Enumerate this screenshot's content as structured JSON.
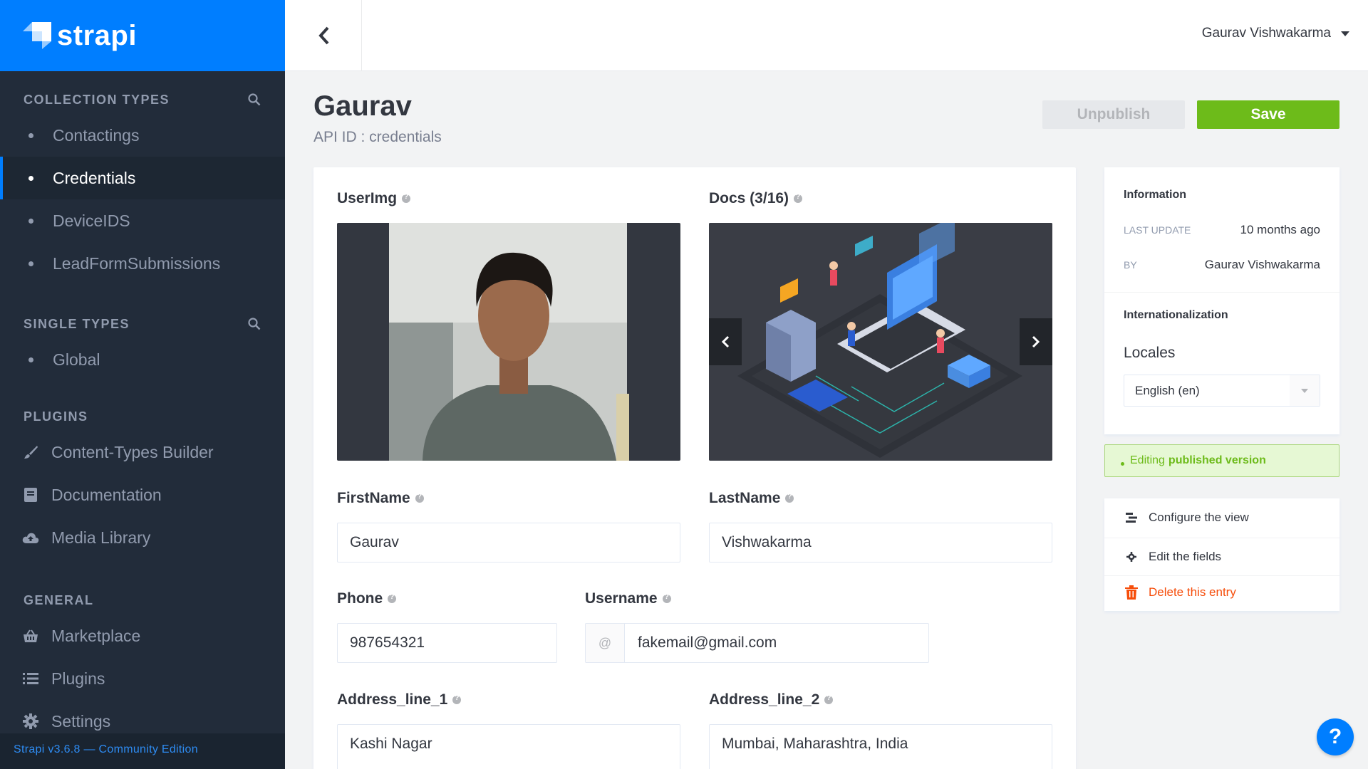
{
  "brand": {
    "name": "strapi"
  },
  "sidebar": {
    "collection_types": {
      "title": "Collection Types",
      "items": [
        {
          "label": "Contactings"
        },
        {
          "label": "Credentials"
        },
        {
          "label": "DeviceIDS"
        },
        {
          "label": "LeadFormSubmissions"
        }
      ]
    },
    "single_types": {
      "title": "Single Types",
      "items": [
        {
          "label": "Global"
        }
      ]
    },
    "plugins": {
      "title": "Plugins",
      "items": [
        {
          "label": "Content-Types Builder",
          "icon": "brush-icon"
        },
        {
          "label": "Documentation",
          "icon": "book-icon"
        },
        {
          "label": "Media Library",
          "icon": "cloud-upload-icon"
        }
      ]
    },
    "general": {
      "title": "General",
      "items": [
        {
          "label": "Marketplace",
          "icon": "basket-icon"
        },
        {
          "label": "Plugins",
          "icon": "list-icon"
        },
        {
          "label": "Settings",
          "icon": "gear-icon"
        }
      ]
    },
    "version": "Strapi v3.6.8 — Community Edition"
  },
  "header": {
    "user": "Gaurav Vishwakarma"
  },
  "page": {
    "title": "Gaurav",
    "subtitle": "API ID : credentials",
    "unpublish_label": "Unpublish",
    "save_label": "Save"
  },
  "form": {
    "userimg_label": "UserImg",
    "docs_label": "Docs (3/16)",
    "firstname_label": "FirstName",
    "firstname_value": "Gaurav",
    "lastname_label": "LastName",
    "lastname_value": "Vishwakarma",
    "phone_label": "Phone",
    "phone_value": "987654321",
    "username_label": "Username",
    "username_prefix": "@",
    "username_value": "fakemail@gmail.com",
    "address1_label": "Address_line_1",
    "address1_value": "Kashi Nagar",
    "address2_label": "Address_line_2",
    "address2_value": "Mumbai, Maharashtra, India"
  },
  "info": {
    "title": "Information",
    "last_update_key": "Last update",
    "last_update_val": "10 months ago",
    "by_key": "By",
    "by_val": "Gaurav Vishwakarma",
    "i18n_title": "Internationalization",
    "locales_label": "Locales",
    "locale_value": "English (en)"
  },
  "banner": {
    "prefix": "Editing",
    "bold": "published version"
  },
  "actions": {
    "configure": "Configure the view",
    "edit_fields": "Edit the fields",
    "delete": "Delete this entry"
  },
  "help": {
    "label": "?"
  },
  "colors": {
    "brand": "#007eff",
    "save": "#6dbb1a",
    "danger": "#f64d0a",
    "sidebar": "#222c3a"
  }
}
